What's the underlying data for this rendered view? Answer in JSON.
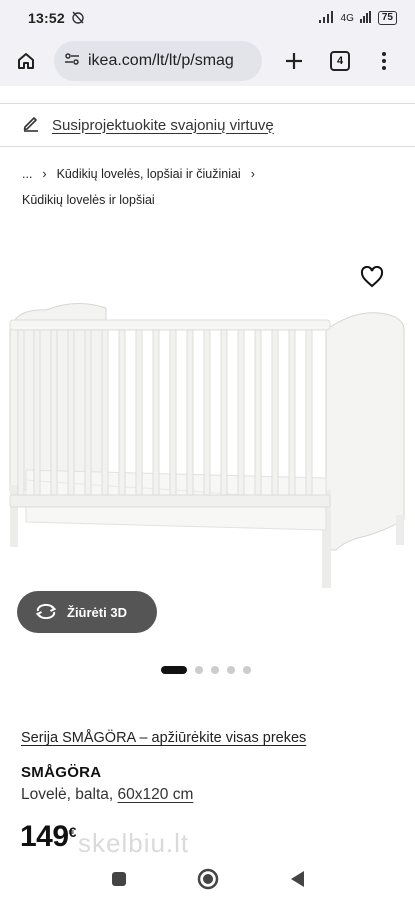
{
  "status_bar": {
    "time": "13:52",
    "network": "4G",
    "battery": "75"
  },
  "browser": {
    "url": "ikea.com/lt/lt/p/smag",
    "tab_count": "4"
  },
  "banner": {
    "text": "Susiprojektuokite svajonių virtuvę"
  },
  "breadcrumb": {
    "ellipsis": "...",
    "parent": "Kūdikių lovelės, lopšiai ir čiužiniai",
    "current": "Kūdikių lovelės ir lopšiai"
  },
  "gallery": {
    "view_3d_label": "Žiūrėti 3D",
    "total_images": 5,
    "active_index": 0
  },
  "product": {
    "series_link": "Serija SMÅGÖRA – apžiūrėkite visas prekes",
    "name": "SMÅGÖRA",
    "description": "Lovelė, balta,",
    "size": "60x120 cm",
    "price": "149",
    "currency": "€"
  },
  "watermark": "skelbiu.lt"
}
